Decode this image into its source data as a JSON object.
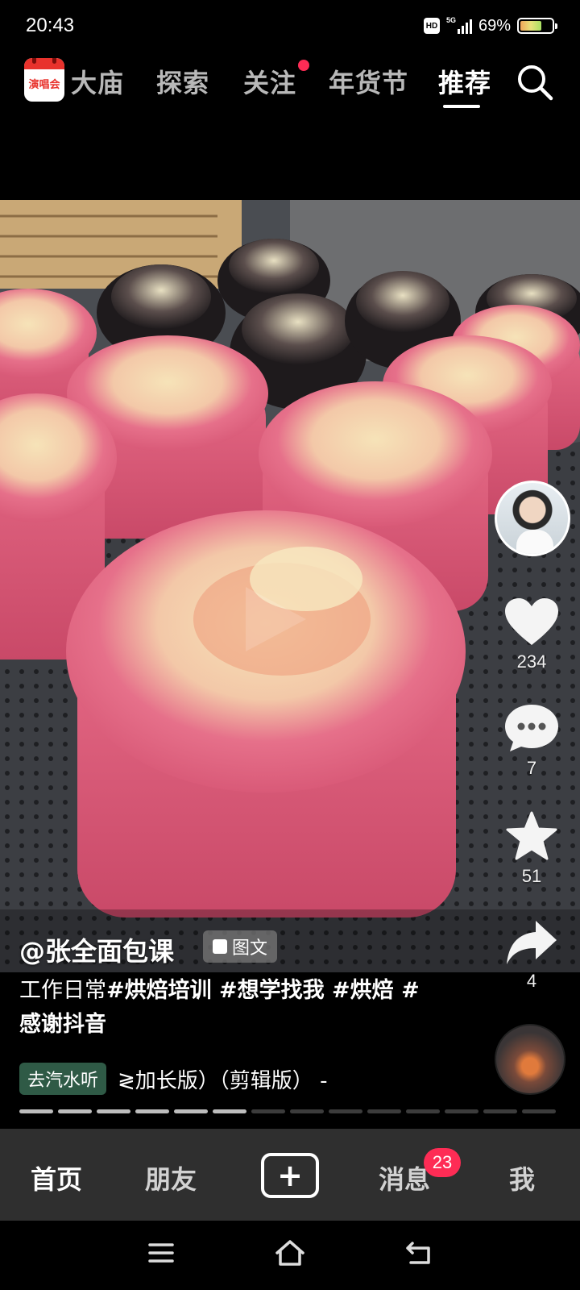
{
  "status": {
    "time": "20:43",
    "battery": "69%",
    "network": "5G",
    "hd": "HD",
    "battery_level": 0.69
  },
  "top_nav": {
    "concert_label": "演唱会",
    "tabs": [
      {
        "label": "大庙"
      },
      {
        "label": "探索"
      },
      {
        "label": "关注"
      },
      {
        "label": "年货节"
      },
      {
        "label": "推荐"
      }
    ],
    "active_tab": "推荐",
    "icons": {
      "search": "search-icon"
    }
  },
  "post": {
    "author": "@张全面包课",
    "type_tag": "图文",
    "caption_plain": "工作日常",
    "caption_tags": "#烘焙培训 #想学找我 #烘焙 #感谢抖音",
    "music_button": "去汽水听",
    "music_title": "≷加长版）（剪辑版） -",
    "image_progress": {
      "total": 14,
      "current": 6
    }
  },
  "actions": {
    "likes": "234",
    "comments": "7",
    "favorites": "51",
    "shares": "4"
  },
  "bottom_tabs": {
    "home": "首页",
    "friends": "朋友",
    "messages": "消息",
    "messages_badge": "23",
    "me": "我"
  },
  "colors": {
    "accent": "#fe2c55",
    "music_button": "#2f5a46",
    "tab_bar": "#2f2f2f"
  }
}
